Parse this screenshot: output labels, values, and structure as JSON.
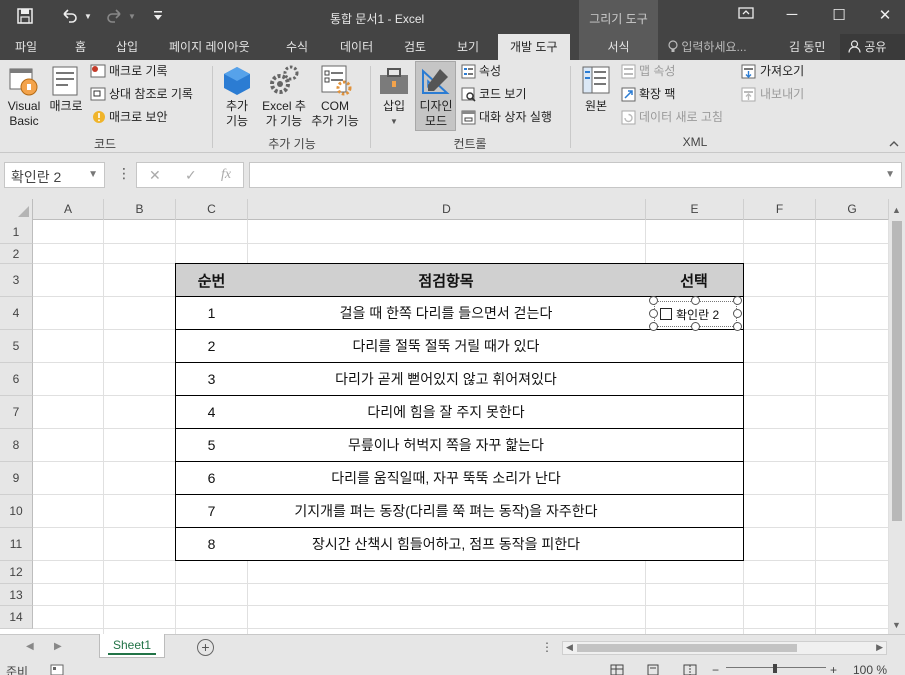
{
  "titlebar": {
    "title": "통합 문서1 - Excel",
    "context_group": "그리기 도구",
    "qat": {
      "save": "save-icon",
      "undo": "undo-icon",
      "redo": "redo-icon",
      "customize": "customize-icon"
    },
    "window_buttons": {
      "restore_ribbon": "ribbon-display-icon",
      "minimize": "─",
      "maximize": "☐",
      "close": "✕"
    }
  },
  "tabs": {
    "items": [
      "파일",
      "홈",
      "삽입",
      "페이지 레이아웃",
      "수식",
      "데이터",
      "검토",
      "보기",
      "개발 도구"
    ],
    "active": "개발 도구",
    "context_tab": "서식",
    "tell_me": "입력하세요...",
    "user": "김 동민",
    "share": "공유"
  },
  "ribbon": {
    "code": {
      "label": "코드",
      "visual_basic_line1": "Visual",
      "visual_basic_line2": "Basic",
      "macro": "매크로",
      "record_macro": "매크로 기록",
      "relative_ref": "상대 참조로 기록",
      "macro_security": "매크로 보안"
    },
    "addins": {
      "label": "추가 기능",
      "addins_line1": "추가",
      "addins_line2": "기능",
      "excel_addins_line1": "Excel 추",
      "excel_addins_line2": "가 기능",
      "com_addins_line1": "COM",
      "com_addins_line2": "추가 기능"
    },
    "controls": {
      "label": "컨트롤",
      "insert": "삽입",
      "design_mode_line1": "디자인",
      "design_mode_line2": "모드",
      "properties": "속성",
      "view_code": "코드 보기",
      "run_dialog": "대화 상자 실행"
    },
    "xml": {
      "label": "XML",
      "source": "원본",
      "map_properties": "맵 속성",
      "expansion_packs": "확장 팩",
      "refresh_data": "데이터 새로 고침",
      "import": "가져오기",
      "export": "내보내기"
    }
  },
  "formula_bar": {
    "name_box": "확인란 2",
    "cancel_icon": "✕",
    "enter_icon": "✓",
    "fx": "fx",
    "formula": ""
  },
  "sheet": {
    "columns": [
      "A",
      "B",
      "C",
      "D",
      "E",
      "F",
      "G"
    ],
    "rows": [
      "1",
      "2",
      "3",
      "4",
      "5",
      "6",
      "7",
      "8",
      "9",
      "10",
      "11",
      "12",
      "13",
      "14"
    ],
    "table_headers": [
      "순번",
      "점검항목",
      "선택"
    ],
    "table_rows": [
      [
        "1",
        "걸을 때 한쪽 다리를 들으면서 걷는다"
      ],
      [
        "2",
        "다리를 절뚝 절뚝 거릴 때가 있다"
      ],
      [
        "3",
        "다리가 곧게 뻗어있지 않고 휘어져있다"
      ],
      [
        "4",
        "다리에 힘을 잘 주지 못한다"
      ],
      [
        "5",
        "무릎이나 허벅지 쪽을 자꾸 핥는다"
      ],
      [
        "6",
        "다리를 움직일때, 자꾸 뚝뚝 소리가 난다"
      ],
      [
        "7",
        "기지개를 펴는 동장(다리를 쭉 펴는 동작)을 자주한다"
      ],
      [
        "8",
        "장시간 산책시 힘들어하고, 점프 동작을 피한다"
      ]
    ],
    "checkbox_label": "확인란 2",
    "checkbox_checked": false
  },
  "sheet_tabs": {
    "active": "Sheet1",
    "add_icon": "⊕",
    "more": "⋮"
  },
  "status": {
    "ready": "준비",
    "zoom": "100 %"
  },
  "colors": {
    "accent": "#217346",
    "titlebar": "#444444",
    "ribbon": "#e6e6e6",
    "table_header": "#d0d0d0"
  }
}
